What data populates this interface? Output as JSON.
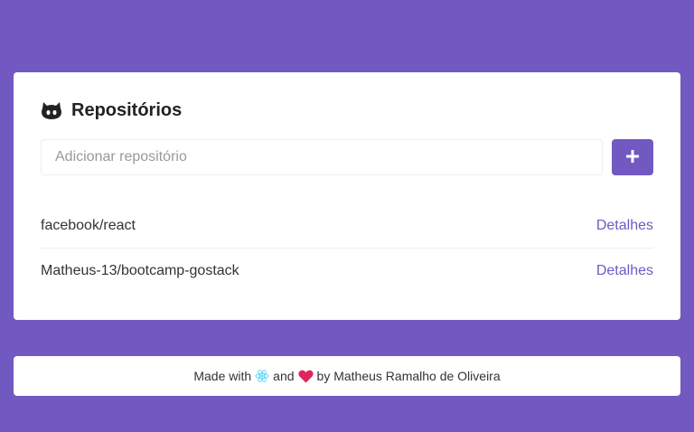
{
  "card": {
    "title": "Repositórios",
    "title_icon": "github-icon"
  },
  "form": {
    "placeholder": "Adicionar repositório",
    "value": "",
    "add_button_icon": "plus-icon"
  },
  "repositories": [
    {
      "name": "facebook/react",
      "link_label": "Detalhes"
    },
    {
      "name": "Matheus-13/bootcamp-gostack",
      "link_label": "Detalhes"
    }
  ],
  "footer": {
    "made_with": "Made with",
    "and": "and",
    "by": "by Matheus Ramalho de Oliveira",
    "icon_1": "react-icon",
    "icon_2": "heart-icon"
  },
  "colors": {
    "background": "#7159c1",
    "accent": "#7159c1",
    "card": "#ffffff",
    "heart": "#e0245e",
    "react": "#61dafb"
  }
}
